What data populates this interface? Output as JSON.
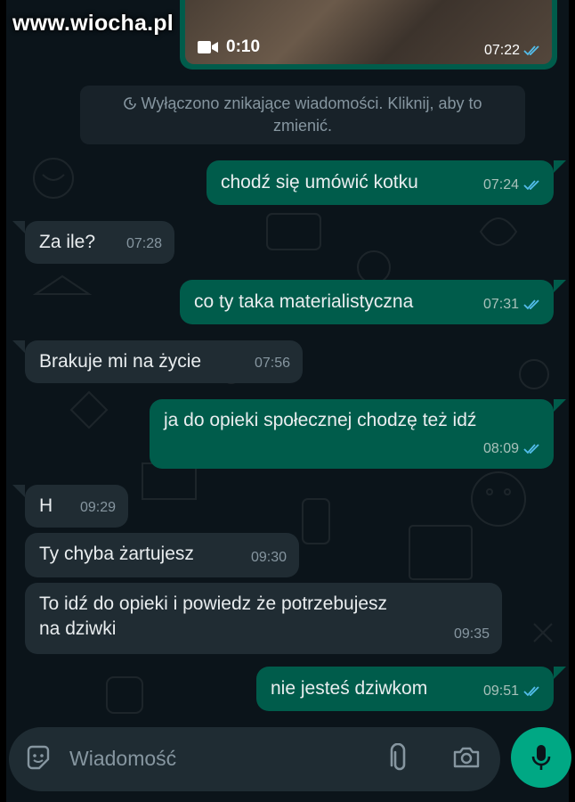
{
  "watermark": "www.wiocha.pl",
  "video_message": {
    "duration": "0:10",
    "time": "07:22"
  },
  "system_note": {
    "line1": "Wyłączono znikające wiadomości. Kliknij, aby to",
    "line2": "zmienić."
  },
  "messages": [
    {
      "dir": "out",
      "text": "chodź się umówić kotku",
      "time": "07:24"
    },
    {
      "dir": "in",
      "text": "Za ile?",
      "time": "07:28"
    },
    {
      "dir": "out",
      "text": "co ty taka materialistyczna",
      "time": "07:31"
    },
    {
      "dir": "in",
      "text": "Brakuje mi na życie",
      "time": "07:56"
    },
    {
      "dir": "out",
      "text": "ja do opieki społecznej chodzę też idź",
      "time": "08:09"
    },
    {
      "dir": "in",
      "text": "H",
      "time": "09:29"
    },
    {
      "dir": "in",
      "text": "Ty chyba żartujesz",
      "time": "09:30"
    },
    {
      "dir": "in",
      "text": "To idź do opieki i powiedz że potrzebujesz",
      "text2": "na dziwki",
      "time": "09:35"
    },
    {
      "dir": "out",
      "text": "nie jesteś dziwkom",
      "time": "09:51"
    }
  ],
  "composer": {
    "placeholder": "Wiadomość"
  },
  "icons": {
    "emoji": "sticker-smile-icon",
    "attach": "paperclip-icon",
    "camera": "camera-icon",
    "mic": "microphone-icon",
    "video": "video-camera-icon",
    "read": "double-check-icon",
    "timer": "timer-off-icon"
  },
  "colors": {
    "background": "#0b141a",
    "outgoing": "#005c4b",
    "incoming": "#202c33",
    "accent": "#00a884",
    "read_ticks": "#53bdeb"
  }
}
